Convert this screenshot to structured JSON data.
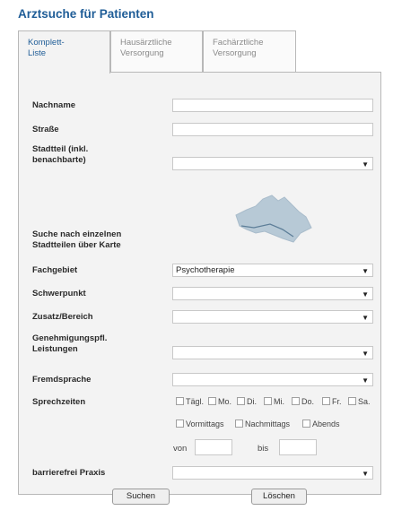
{
  "page_title": "Arztsuche für Patienten",
  "tabs": [
    {
      "line1": "Komplett-",
      "line2": "Liste"
    },
    {
      "line1": "Hausärztliche",
      "line2": "Versorgung"
    },
    {
      "line1": "Fachärztliche",
      "line2": "Versorgung"
    }
  ],
  "form": {
    "nachname_label": "Nachname",
    "nachname_value": "",
    "strasse_label": "Straße",
    "strasse_value": "",
    "stadtteil_label_1": "Stadtteil (inkl.",
    "stadtteil_label_2": "benachbarte)",
    "stadtteil_value": "",
    "karte_label_1": "Suche nach einzelnen",
    "karte_label_2": "Stadtteilen über Karte",
    "fachgebiet_label": "Fachgebiet",
    "fachgebiet_value": "Psychotherapie",
    "schwerpunkt_label": "Schwerpunkt",
    "schwerpunkt_value": "",
    "zusatz_label": "Zusatz/Bereich",
    "zusatz_value": "",
    "leistungen_label_1": "Genehmigungspfl.",
    "leistungen_label_2": "Leistungen",
    "leistungen_value": "",
    "fremdsprache_label": "Fremdsprache",
    "fremdsprache_value": "",
    "sprechzeiten_label": "Sprechzeiten",
    "days": [
      "Tägl.",
      "Mo.",
      "Di.",
      "Mi.",
      "Do.",
      "Fr.",
      "Sa."
    ],
    "times": [
      "Vormittags",
      "Nachmittags",
      "Abends"
    ],
    "von_label": "von",
    "bis_label": "bis",
    "barrierefrei_label": "barrierefrei Praxis",
    "barrierefrei_value": ""
  },
  "buttons": {
    "suchen": "Suchen",
    "loeschen": "Löschen"
  },
  "icons": {
    "dropdown": "chevron-down-icon",
    "map": "hamburg-map-icon"
  },
  "colors": {
    "accent": "#1f5d97",
    "panel": "#f3f3f3",
    "map": "#b7c9d6"
  }
}
